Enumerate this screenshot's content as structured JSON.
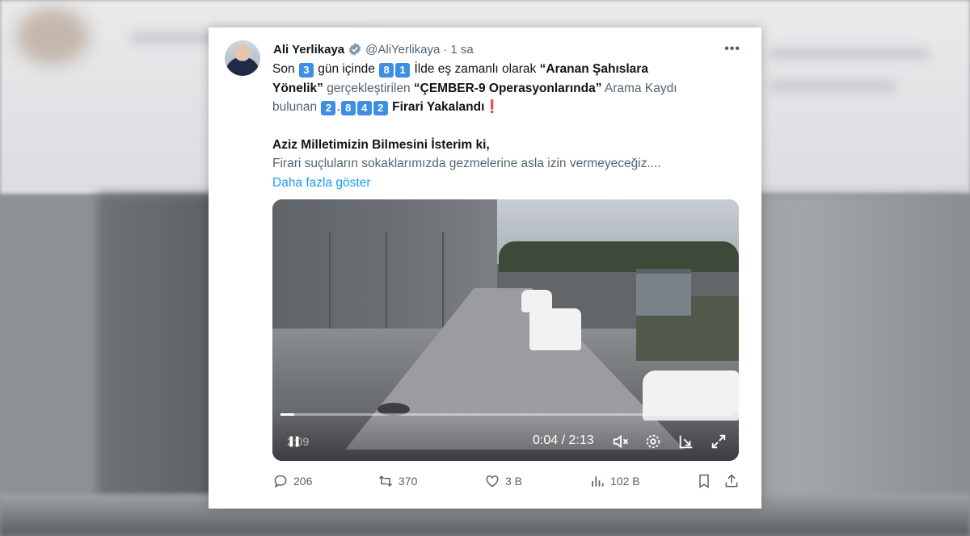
{
  "tweet": {
    "author_name": "Ali Yerlikaya",
    "handle": "@AliYerlikaya",
    "separator": "·",
    "time": "1 sa",
    "text": {
      "l1_a": "Son ",
      "l1_n1": "3",
      "l1_b": " gün içinde ",
      "l1_n2a": "8",
      "l1_n2b": "1",
      "l1_c": " İlde eş zamanlı olarak  ",
      "l1_bold": "“Aranan Şahıslara",
      "l2_bold": "Yönelik”",
      "l2_b": " gerçekleştirilen ",
      "l2_bold2": "“ÇEMBER-9 Operasyonlarında”",
      "l2_c": " Arama Kaydı",
      "l3_a": "bulunan ",
      "l3_n1": "2",
      "l3_dot": ".",
      "l3_n2": "8",
      "l3_n3": "4",
      "l3_n4": "2",
      "l3_bold": " Firari Yakalandı",
      "l3_excl": "❗",
      "l4_bold": "Aziz Milletimizin Bilmesini İsterim ki,",
      "l5": "Firari suçluların sokaklarımızda gezmelerine asla izin vermeyeceğiz...."
    },
    "show_more": "Daha fazla göster"
  },
  "video": {
    "current_time": "0:04 / 2:13",
    "duration_overlay": "2:09",
    "progress": 0.03
  },
  "actions": {
    "replies": "206",
    "retweets": "370",
    "likes": "3 B",
    "views": "102 B"
  },
  "colors": {
    "accent": "#1d9bf0",
    "muted": "#536471",
    "number_box": "#3f8ee6"
  }
}
